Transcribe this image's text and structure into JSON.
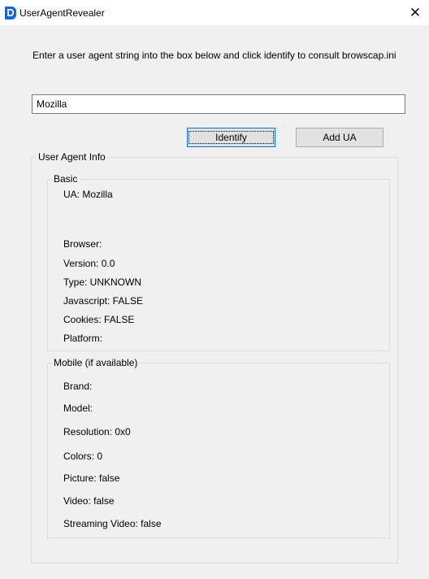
{
  "window": {
    "app_icon_letter": "D",
    "title": "UserAgentRevealer",
    "close_glyph": "✕"
  },
  "instructions": "Enter a user agent string into the box below and click identify to consult browscap.ini",
  "ua_input": {
    "value": "Mozilla"
  },
  "buttons": {
    "identify": "Identify",
    "add_ua": "Add UA"
  },
  "groups": {
    "user_agent_info": "User Agent Info",
    "basic": "Basic",
    "mobile": "Mobile (if available)"
  },
  "basic": {
    "ua": "UA: Mozilla",
    "browser": "Browser:",
    "version": "Version: 0.0",
    "type": "Type: UNKNOWN",
    "javascript": "Javascript: FALSE",
    "cookies": "Cookies: FALSE",
    "platform": "Platform:"
  },
  "mobile": {
    "brand": "Brand:",
    "model": "Model:",
    "resolution": "Resolution: 0x0",
    "colors": "Colors: 0",
    "picture": "Picture: false",
    "video": "Video: false",
    "streaming_video": "Streaming Video: false"
  },
  "colors": {
    "app_icon": "#1565d8",
    "focus_border": "#0078d7"
  }
}
